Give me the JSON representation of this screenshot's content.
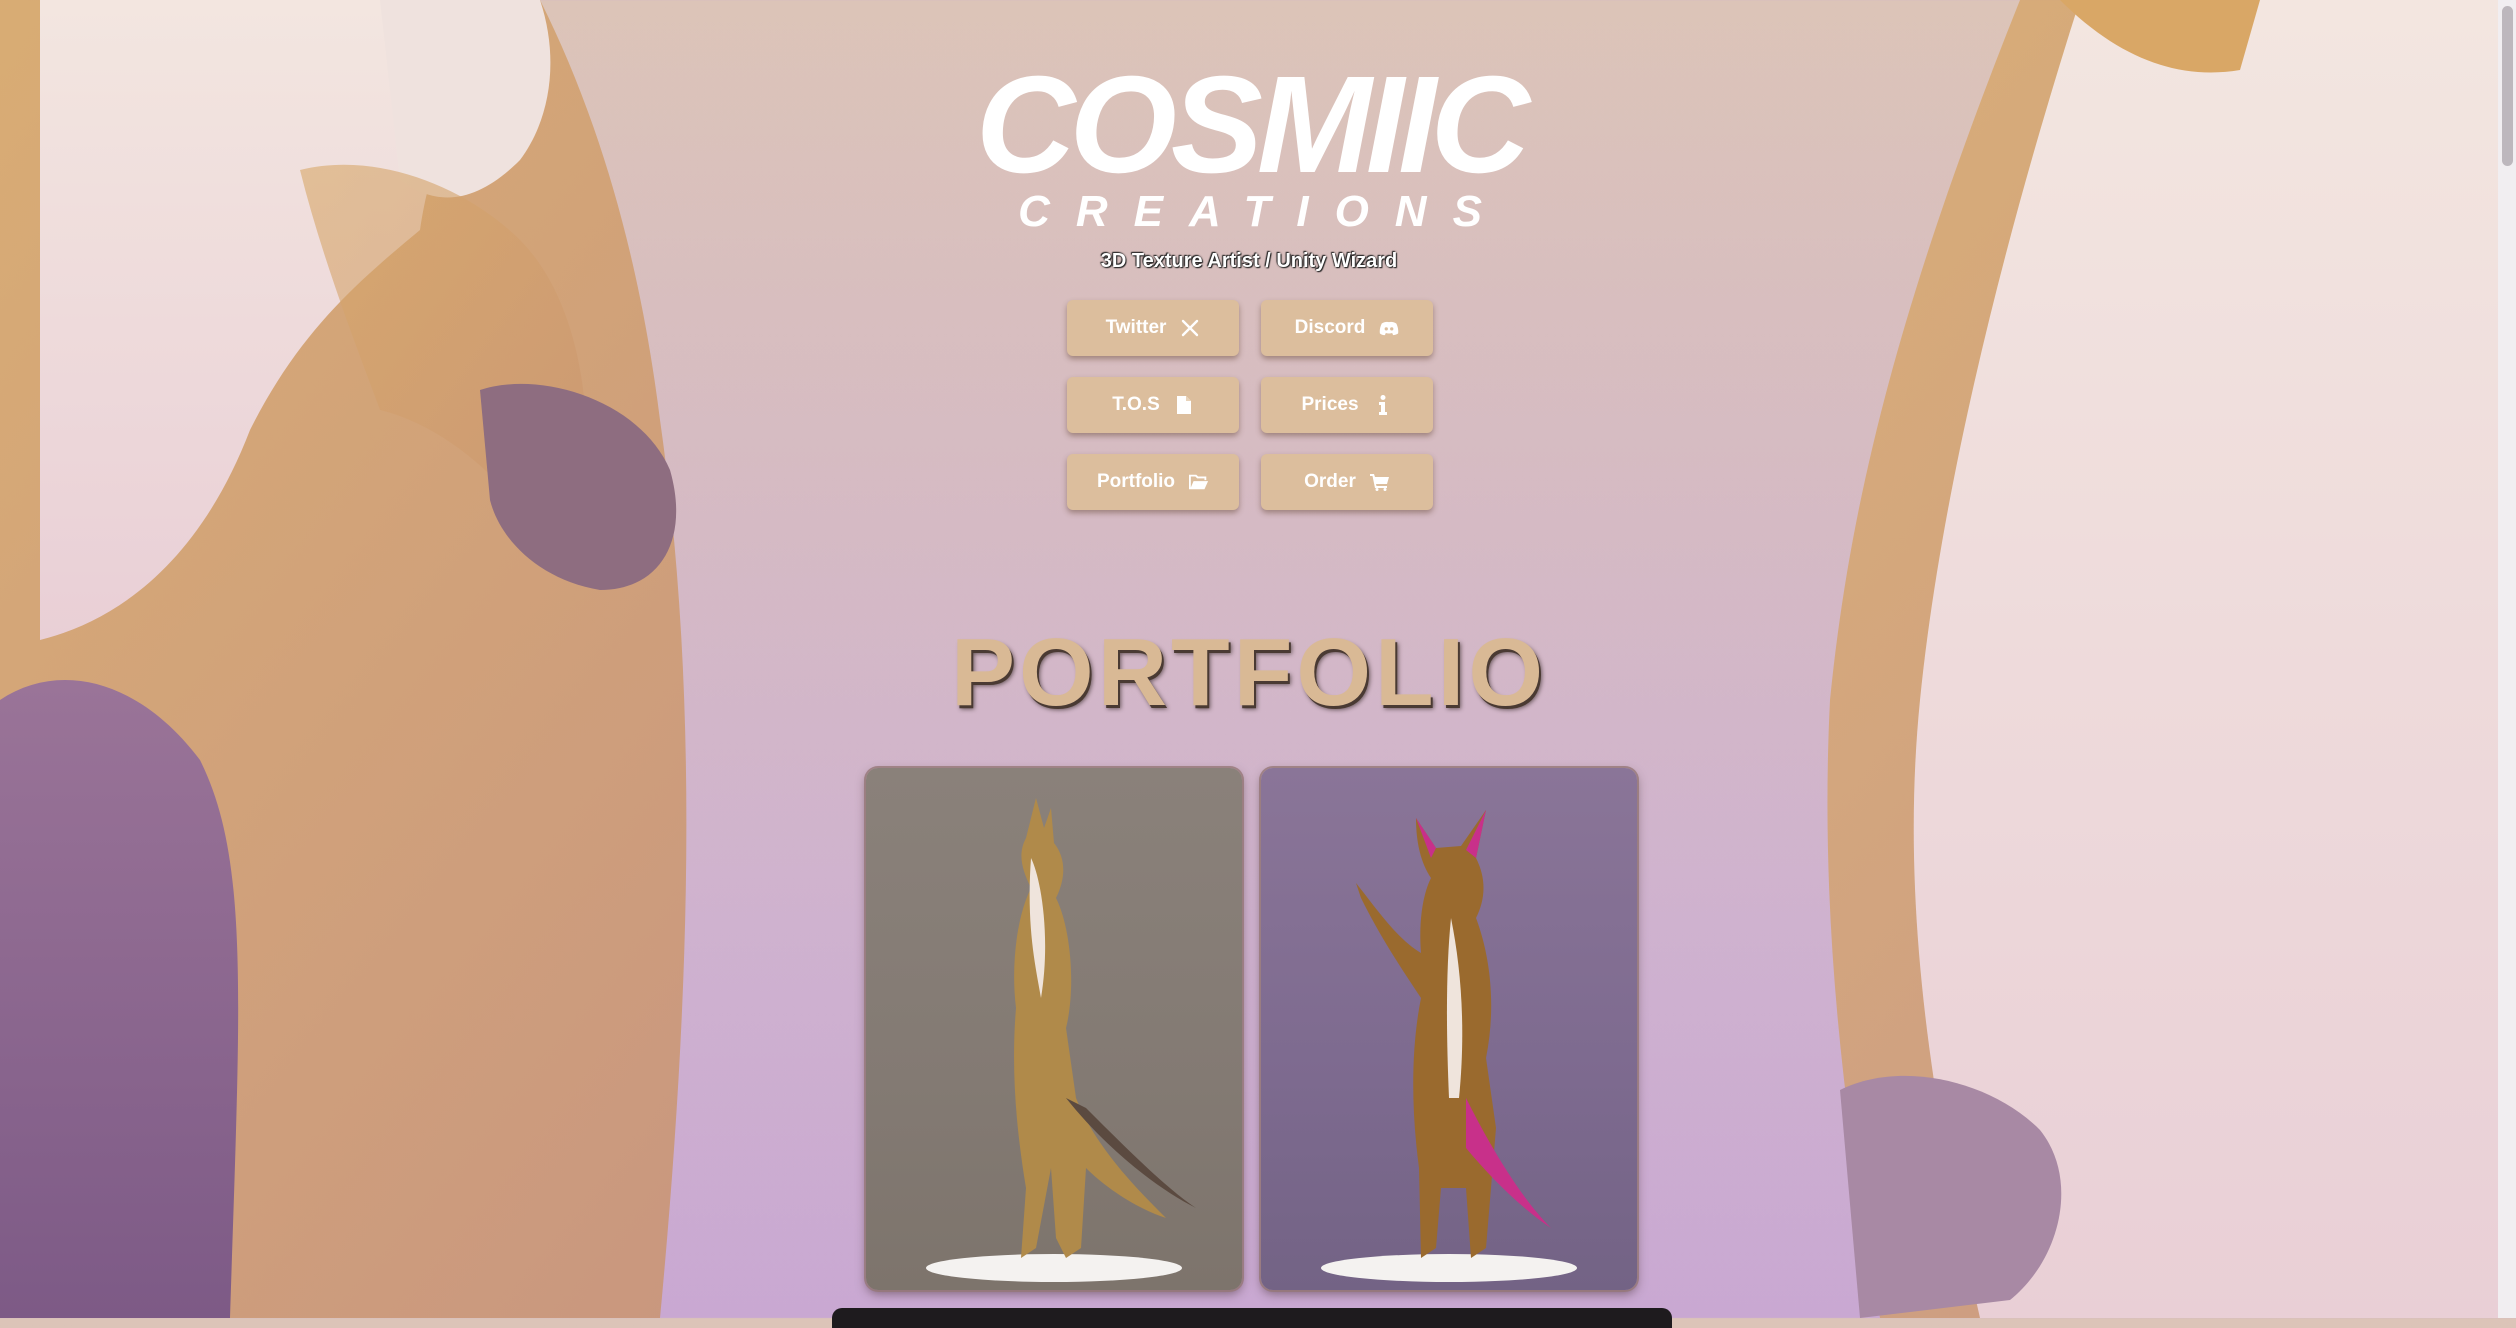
{
  "logo": {
    "line1": "COSMIIC",
    "line2": "CREATIONS"
  },
  "subtitle": "3D Texture Artist / Unity Wizard",
  "buttons": {
    "twitter": {
      "label": "Twitter",
      "icon": "x-icon"
    },
    "discord": {
      "label": "Discord",
      "icon": "discord-icon"
    },
    "tos": {
      "label": "T.O.S",
      "icon": "file-icon"
    },
    "prices": {
      "label": "Prices",
      "icon": "info-icon"
    },
    "portfolio": {
      "label": "Portfolio",
      "icon": "folder-open-icon"
    },
    "order": {
      "label": "Order",
      "icon": "cart-icon"
    }
  },
  "section": {
    "title": "PORTFOLIO"
  },
  "colors": {
    "button_bg": "#dcbe9d",
    "title_color": "#d9b995",
    "text": "#ffffff"
  }
}
